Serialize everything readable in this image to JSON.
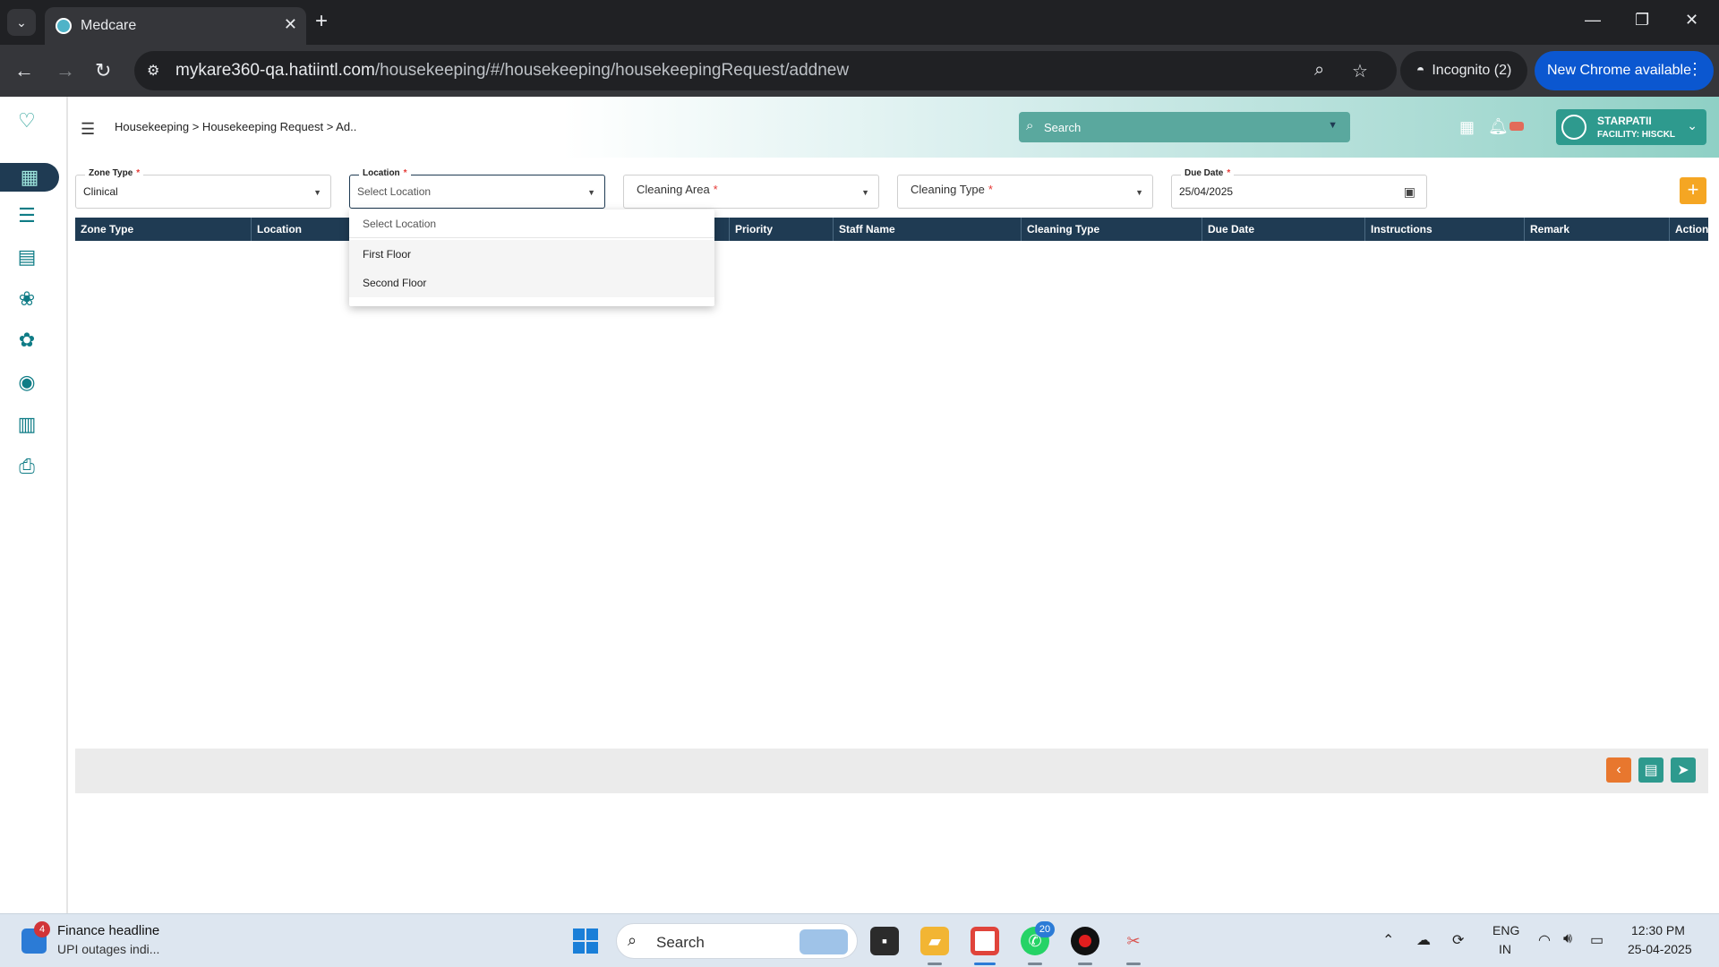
{
  "browser": {
    "tab_title": "Medcare",
    "url_host": "mykare360-qa.hatiintl.com",
    "url_path": "/housekeeping/#/housekeeping/housekeepingRequest/addnew",
    "incognito_label": "Incognito (2)",
    "update_label": "New Chrome available"
  },
  "header": {
    "breadcrumb": "Housekeeping > Housekeeping Request > Ad..",
    "search_placeholder": "Search",
    "user_name": "STARPATII",
    "facility": "FACILITY: HISCKL"
  },
  "sidebar": {
    "icons": [
      "housekeeping-icon",
      "request-list-icon",
      "dashboard-icon",
      "plant-care-icon",
      "staff-care-icon",
      "report-icon",
      "analytics-icon",
      "printer-icon"
    ]
  },
  "form": {
    "zone_type": {
      "label": "Zone Type",
      "value": "Clinical"
    },
    "location": {
      "label": "Location",
      "placeholder": "Select Location"
    },
    "cleaning_area": {
      "label": "Cleaning Area"
    },
    "cleaning_type": {
      "label": "Cleaning Type"
    },
    "due_date": {
      "label": "Due Date",
      "value": "25/04/2025"
    },
    "add_label": "+"
  },
  "dropdown": {
    "placeholder": "Select Location",
    "options": [
      "First Floor",
      "Second Floor"
    ]
  },
  "table": {
    "columns": [
      "Zone Type",
      "Location",
      "Priority",
      "Staff Name",
      "Cleaning Type",
      "Due Date",
      "Instructions",
      "Remark",
      "Action"
    ]
  },
  "taskbar": {
    "news_title": "Finance headline",
    "news_sub": "UPI outages indi...",
    "news_badge": "4",
    "search_label": "Search",
    "whatsapp_badge": "20",
    "lang1": "ENG",
    "lang2": "IN",
    "time": "12:30 PM",
    "date": "25-04-2025"
  },
  "colors": {
    "primary": "#1f3b53",
    "accent": "#2e9a8e",
    "add_button": "#f5a623",
    "required": "#e53935"
  }
}
